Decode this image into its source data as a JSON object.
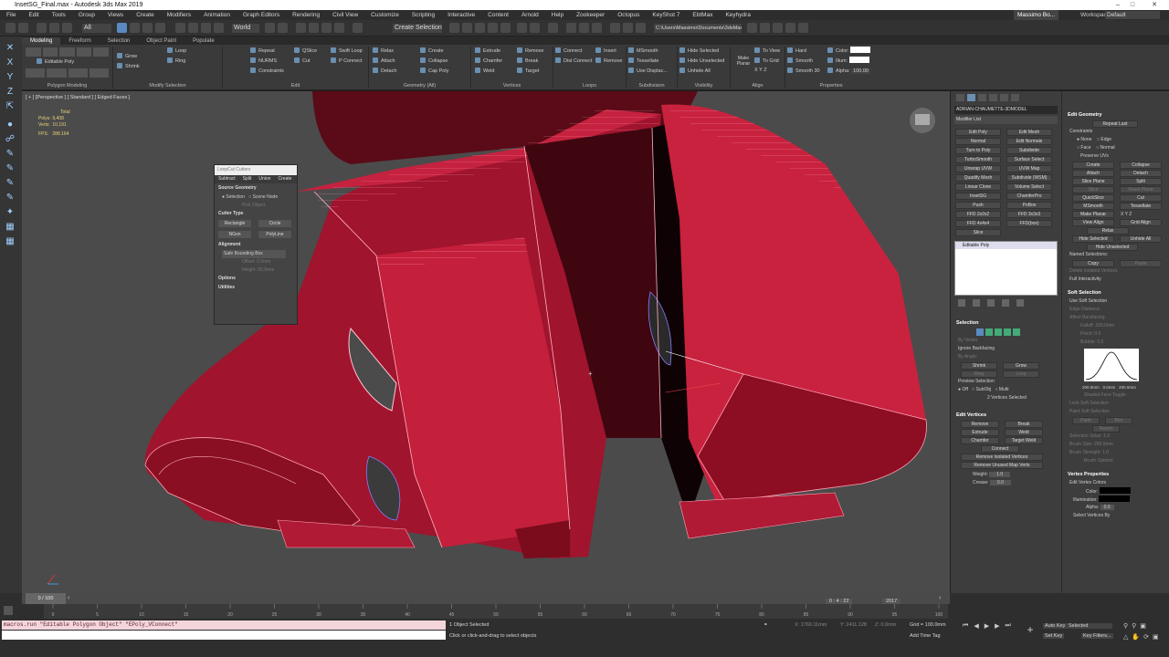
{
  "window": {
    "title": "InsetSG_Final.max - Autodesk 3ds Max 2019"
  },
  "menu": [
    "File",
    "Edit",
    "Tools",
    "Group",
    "Views",
    "Create",
    "Modifiers",
    "Animation",
    "Graph Editors",
    "Rendering",
    "Civil View",
    "Customize",
    "Scripting",
    "Interactive",
    "Content",
    "Arnold",
    "Help",
    "Zookeeper",
    "Octopus",
    "KeyShot 7",
    "EbtMax",
    "Keyhydra"
  ],
  "user": {
    "name": "Massimo Bo...",
    "workspaces_label": "Workspaces:",
    "workspace": "Default"
  },
  "toolbar": {
    "selection_filter": "All",
    "coord": "World",
    "selection_set": "Create Selection Se",
    "path": "C:\\Users\\Massimo\\Documents\\3dsMax"
  },
  "ribbon": {
    "tabs": [
      "Modeling",
      "Freeform",
      "Selection",
      "Object Paint",
      "Populate"
    ],
    "groups": [
      {
        "label": "Polygon Modeling",
        "items": [
          "Editable Poly"
        ]
      },
      {
        "label": "Modify Selection",
        "items": [
          "Grow",
          "Shrink",
          "Loop",
          "Ring"
        ]
      },
      {
        "label": "Edit",
        "items": [
          "Repeat",
          "QSlice",
          "Swift Loop",
          "NURMS",
          "Cut",
          "P Connect",
          "Constraints"
        ]
      },
      {
        "label": "Geometry (All)",
        "items": [
          "Relax",
          "Create",
          "Remove",
          "Attach",
          "Collapse",
          "Detach",
          "Cap Poly"
        ]
      },
      {
        "label": "Vertices",
        "items": [
          "Extrude",
          "Remove",
          "Chamfer",
          "Break",
          "Weld",
          "Target"
        ]
      },
      {
        "label": "Loops",
        "items": [
          "Connect",
          "Insert",
          "Dist Connect",
          "Remove"
        ]
      },
      {
        "label": "Subdivision",
        "items": [
          "MSmooth",
          "Tessellate",
          "Use Displac..."
        ]
      },
      {
        "label": "Visibility",
        "items": [
          "Hide Selected",
          "Hide Unselected",
          "Unhide All"
        ]
      },
      {
        "label": "Align",
        "items": [
          "Make Planar",
          "To View",
          "To Grid",
          "X",
          "Y",
          "Z"
        ]
      },
      {
        "label": "Properties",
        "items": [
          "Hard",
          "Smooth",
          "Smooth 30",
          "Color:",
          "Illum:",
          "Alpha:"
        ]
      }
    ],
    "alpha_value": "100.00"
  },
  "viewport": {
    "label": "[ + ] [Perspective ] [ Standard ] [ Edged Faces ]",
    "stats": {
      "total": "Total",
      "polys_label": "Polys:",
      "polys": "9,408",
      "verts_label": "Verts:",
      "verts": "10,191",
      "fps_label": "FPS:",
      "fps": "288.164"
    }
  },
  "cutter": {
    "title": "LoopCut Cutters",
    "tabs": [
      "Subtract",
      "Split",
      "Union",
      "Create"
    ],
    "source_geometry": "Source Geometry",
    "selection": "Selection",
    "scene_node": "Scene Node",
    "pick_object": "Pick Object",
    "cutter_type": "Cutter Type",
    "rect": "Rectangle",
    "circle": "Circle",
    "ngon": "NGon",
    "polyline": "PolyLine",
    "alignment": "Alignment",
    "align_opt": "Safe Bounding Box",
    "offset": "Offset:",
    "offset_v": "0.0mm",
    "height": "Height:",
    "height_v": "50.0mm",
    "options": "Options",
    "utilities": "Utilities"
  },
  "command_panel": {
    "object_name": "ADRIAN-CHAUMETTE-3DMODEL",
    "modifier_list": "Modifier List",
    "buttons": [
      "Edit Poly",
      "Edit Mesh",
      "Normal",
      "Edit Normals",
      "Turn to Poly",
      "Subdivide",
      "TurboSmooth",
      "Surface Select",
      "Unwrap UVW",
      "UVW Map",
      "Quadify Mesh",
      "Subdivide (WSM)",
      "Linear Clone",
      "Volume Select",
      "InsetSG",
      "ChamferPro",
      "Push",
      "PoBox",
      "FFD 2x2x2",
      "FFD 3x3x3",
      "FFD 4x4x4",
      "FFD(box)",
      "Slice"
    ],
    "stack_item": "Editable Poly",
    "selection": {
      "title": "Selection",
      "by_vertex": "By Vertex",
      "ignore_backfacing": "Ignore Backfacing",
      "by_angle": "By Angle:",
      "shrink": "Shrink",
      "grow": "Grow",
      "ring": "Ring",
      "loop": "Loop",
      "preview": "Preview Selection",
      "off": "Off",
      "subobj": "SubObj",
      "multi": "Multi",
      "status": "2 Vertices Selected"
    },
    "edit_vertices": {
      "title": "Edit Vertices",
      "remove": "Remove",
      "break": "Break",
      "extrude": "Extrude",
      "weld": "Weld",
      "chamfer": "Chamfer",
      "target_weld": "Target Weld",
      "connect": "Connect",
      "remove_isolated": "Remove Isolated Vertices",
      "remove_unused": "Remove Unused Map Verts",
      "weight_label": "Weight:",
      "weight": "1.0",
      "crease_label": "Crease:",
      "crease": "0.0"
    }
  },
  "props": {
    "edit_geometry": {
      "title": "Edit Geometry",
      "repeat_last": "Repeat Last",
      "constraints": "Constraints",
      "none": "None",
      "edge": "Edge",
      "face": "Face",
      "normal": "Normal",
      "preserve_uvs": "Preserve UVs",
      "create": "Create",
      "collapse": "Collapse",
      "attach": "Attach",
      "detach": "Detach",
      "slice_plane": "Slice Plane",
      "split": "Split",
      "slice": "Slice",
      "reset_plane": "Reset Plane",
      "quickslice": "QuickSlice",
      "cut": "Cut",
      "msmooth": "MSmooth",
      "tessellate": "Tessellate",
      "make_planar": "Make Planar",
      "x": "X",
      "y": "Y",
      "z": "Z",
      "view_align": "View Align",
      "grid_align": "Grid Align",
      "relax": "Relax",
      "hide_sel": "Hide Selected",
      "unhide_all": "Unhide All",
      "hide_unsel": "Hide Unselected",
      "named_sel": "Named Selections:",
      "copy": "Copy",
      "paste": "Paste",
      "delete_isolated": "Delete Isolated Vertices",
      "full_interactivity": "Full Interactivity"
    },
    "soft_selection": {
      "title": "Soft Selection",
      "use_soft": "Use Soft Selection",
      "edge_distance": "Edge Distance:",
      "affect_backfacing": "Affect Backfacing",
      "falloff": "Falloff:",
      "falloff_v": "200.0mm",
      "pinch": "Pinch:",
      "pinch_v": "0.0",
      "bubble": "Bubble:",
      "bubble_v": "0.0",
      "curve_left": "200.0mm",
      "curve_mid": "0.0mm",
      "curve_right": "200.0mm",
      "shaded_face": "Shaded Face Toggle",
      "lock": "Lock Soft Selection",
      "paint_soft": "Paint Soft Selection",
      "paint": "Paint",
      "blur": "Blur",
      "revert": "Revert",
      "sel_value": "Selection Value:",
      "sel_value_v": "1.0",
      "brush_size": "Brush Size:",
      "brush_size_v": "200.0mm",
      "brush_strength": "Brush Strength:",
      "brush_strength_v": "1.0",
      "brush_options": "Brush Options"
    },
    "vertex_props": {
      "title": "Vertex Properties",
      "edit_colors": "Edit Vertex Colors",
      "color": "Color:",
      "illum": "Illumination:",
      "alpha": "Alpha:",
      "alpha_v": "0.0",
      "select_by": "Select Vertices By"
    }
  },
  "timeline": {
    "frame": "0 / 100",
    "ticks": [
      "0",
      "5",
      "10",
      "15",
      "20",
      "25",
      "30",
      "35",
      "40",
      "45",
      "50",
      "55",
      "60",
      "65",
      "70",
      "75",
      "80",
      "85",
      "90",
      "95",
      "100"
    ]
  },
  "status": {
    "maxscript": "macros.run \"Editable Polygon Object\" \"EPoly_VConnect\"",
    "selected": "1 Object Selected",
    "prompt": "Click or click-and-drag to select objects",
    "x": "X: 1769.11mm",
    "y": "Y: 2411.128",
    "z": "Z: 0.0mm",
    "grid": "Grid = 100.0mm",
    "add_time_tag": "Add Time Tag",
    "autokey": "Auto Key",
    "selected_opt": "Selected",
    "setkey": "Set Key",
    "keyfilters": "Key Filters...",
    "time": "0 : 4 : 22",
    "year": "2017"
  }
}
